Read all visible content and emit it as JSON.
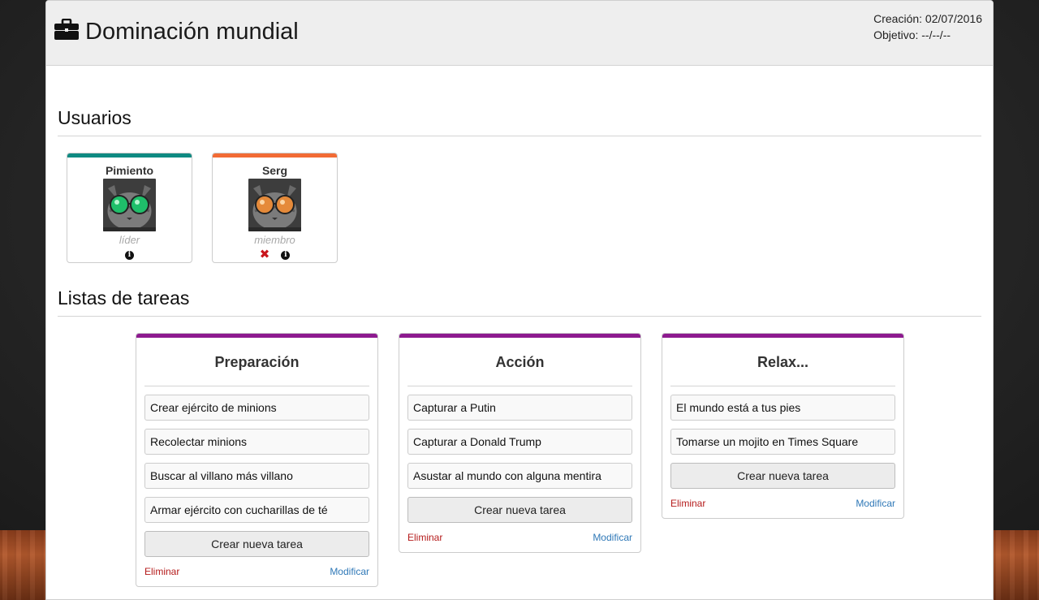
{
  "project": {
    "title": "Dominación mundial",
    "created": "Creación: 02/07/2016",
    "objective": "Objetivo: --/--/--"
  },
  "users_section": {
    "title": "Usuarios"
  },
  "users": [
    {
      "name": "Pimiento",
      "role": "líder",
      "color": "#0f8a82",
      "lens_color": "#1fbf6a"
    },
    {
      "name": "Serg",
      "role": "miembro",
      "color": "#f26b35",
      "lens_color": "#e58a3a"
    }
  ],
  "lists_section": {
    "title": "Listas de tareas"
  },
  "lists": [
    {
      "title": "Preparación",
      "tasks": [
        "Crear ejército de minions",
        "Recolectar minions",
        "Buscar al villano más villano",
        "Armar ejército con cucharillas de té"
      ],
      "new_task_label": "Crear nueva tarea",
      "delete_label": "Eliminar",
      "modify_label": "Modificar"
    },
    {
      "title": "Acción",
      "tasks": [
        "Capturar a Putin",
        "Capturar a Donald Trump",
        "Asustar al mundo con alguna mentira"
      ],
      "new_task_label": "Crear nueva tarea",
      "delete_label": "Eliminar",
      "modify_label": "Modificar"
    },
    {
      "title": "Relax...",
      "tasks": [
        "El mundo está a tus pies",
        "Tomarse un mojito en Times Square"
      ],
      "new_task_label": "Crear nueva tarea",
      "delete_label": "Eliminar",
      "modify_label": "Modificar"
    }
  ],
  "colors": {
    "list_accent": "#8d1a8f",
    "delete": "#b51b1b",
    "modify": "#2f78b7"
  }
}
